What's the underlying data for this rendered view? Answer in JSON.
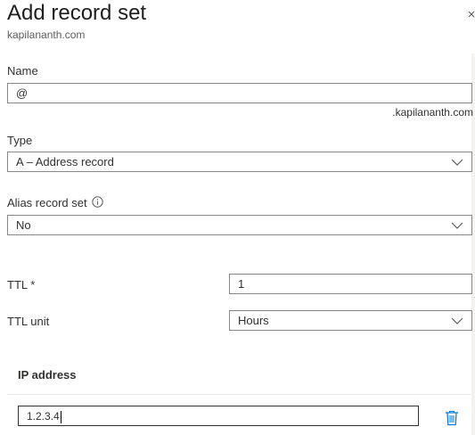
{
  "panel": {
    "title": "Add record set",
    "subtitle": "kapilananth.com"
  },
  "form": {
    "name": {
      "label": "Name",
      "value": "@",
      "suffix": ".kapilananth.com"
    },
    "type": {
      "label": "Type",
      "selected": "A – Address record"
    },
    "alias": {
      "label": "Alias record set",
      "selected": "No"
    },
    "ttl": {
      "label": "TTL *",
      "value": "1"
    },
    "ttl_unit": {
      "label": "TTL unit",
      "selected": "Hours"
    }
  },
  "ip_section": {
    "header": "IP address",
    "rows": [
      {
        "value": "1.2.3.4"
      }
    ]
  },
  "colors": {
    "border": "#8a8886",
    "text": "#323130",
    "accent": "#0078d4"
  },
  "icons": {
    "close": "close-icon",
    "info": "info-icon",
    "chevron": "chevron-down-icon",
    "delete": "trash-icon"
  }
}
